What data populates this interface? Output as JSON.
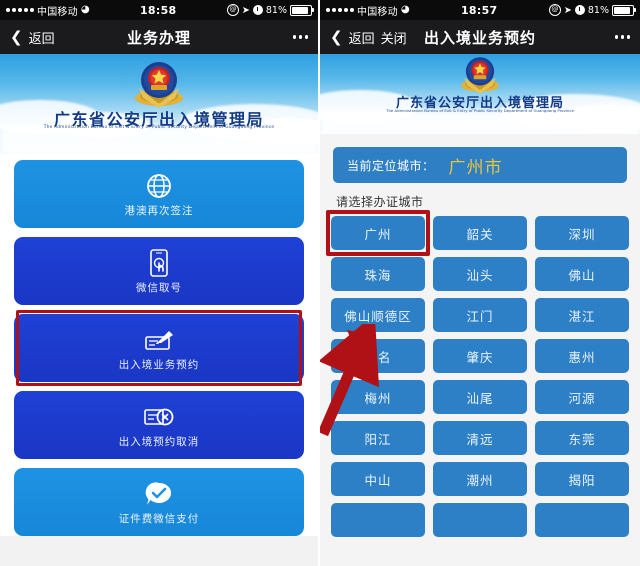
{
  "left": {
    "status": {
      "carrier": "中国移动",
      "wifi_icon": "wifi-icon",
      "time": "18:58",
      "battery_percent": "81%",
      "icons": [
        "alarm-icon",
        "location-arrow-icon",
        "clock-icon",
        "battery-icon"
      ]
    },
    "nav": {
      "back_label": "返回",
      "title": "业务办理",
      "more_icon": "more-dots-icon"
    },
    "banner": {
      "emblem_icon": "police-emblem-icon",
      "title": "广东省公安厅出入境管理局",
      "subtitle": "The Administration Bureau of Exit & Entry of Public Security Department of Guangdong Province"
    },
    "menu_items": [
      {
        "label": "港澳再次签注",
        "icon": "globe-icon",
        "style": "light",
        "highlighted": false
      },
      {
        "label": "微信取号",
        "icon": "phone-tap-icon",
        "style": "dark",
        "highlighted": false
      },
      {
        "label": "出入境业务预约",
        "icon": "pencil-card-icon",
        "style": "dark",
        "highlighted": true
      },
      {
        "label": "出入境预约取消",
        "icon": "card-cancel-icon",
        "style": "dark",
        "highlighted": false
      },
      {
        "label": "证件费微信支付",
        "icon": "check-bubble-icon",
        "style": "light",
        "highlighted": false
      }
    ]
  },
  "right": {
    "status": {
      "carrier": "中国移动",
      "wifi_icon": "wifi-icon",
      "time": "18:57",
      "battery_percent": "81%",
      "icons": [
        "alarm-icon",
        "location-arrow-icon",
        "clock-icon",
        "battery-icon"
      ]
    },
    "nav": {
      "back_label": "返回",
      "close_label": "关闭",
      "title": "出入境业务预约",
      "more_icon": "more-dots-icon"
    },
    "banner": {
      "emblem_icon": "police-emblem-icon",
      "title": "广东省公安厅出入境管理局",
      "subtitle": "The Administration Bureau of Exit & Entry of Public Security Department of Guangdong Province"
    },
    "location_bar": {
      "label": "当前定位城市：",
      "city": "广州市",
      "city_color": "#e8c53f"
    },
    "choose_label": "请选择办证城市",
    "cities": [
      {
        "name": "广州",
        "selected": true
      },
      {
        "name": "韶关",
        "selected": false
      },
      {
        "name": "深圳",
        "selected": false
      },
      {
        "name": "珠海",
        "selected": false
      },
      {
        "name": "汕头",
        "selected": false
      },
      {
        "name": "佛山",
        "selected": false
      },
      {
        "name": "佛山顺德区",
        "selected": false
      },
      {
        "name": "江门",
        "selected": false
      },
      {
        "name": "湛江",
        "selected": false
      },
      {
        "name": "茂名",
        "selected": false
      },
      {
        "name": "肇庆",
        "selected": false
      },
      {
        "name": "惠州",
        "selected": false
      },
      {
        "name": "梅州",
        "selected": false
      },
      {
        "name": "汕尾",
        "selected": false
      },
      {
        "name": "河源",
        "selected": false
      },
      {
        "name": "阳江",
        "selected": false
      },
      {
        "name": "清远",
        "selected": false
      },
      {
        "name": "东莞",
        "selected": false
      },
      {
        "name": "中山",
        "selected": false
      },
      {
        "name": "潮州",
        "selected": false
      },
      {
        "name": "揭阳",
        "selected": false
      },
      {
        "name": "",
        "selected": false
      },
      {
        "name": "",
        "selected": false
      },
      {
        "name": "",
        "selected": false
      }
    ],
    "annotation": {
      "arrow_icon": "red-arrow-icon",
      "color": "#b01116"
    }
  }
}
